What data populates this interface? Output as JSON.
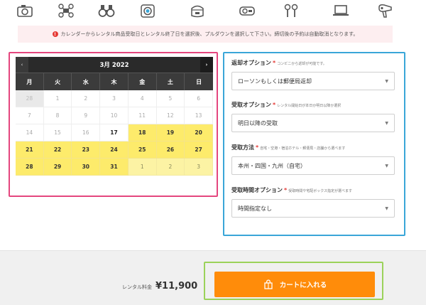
{
  "icons": [
    "camera-icon",
    "drone-icon",
    "binoculars-icon",
    "action-camera-icon",
    "rice-cooker-icon",
    "projector-icon",
    "earbuds-icon",
    "laptop-icon",
    "hair-dryer-icon"
  ],
  "notice": {
    "text": "カレンダーからレンタル商品受取日とレンタル終了日を選択後、プルダウンを選択して下さい。締切後の予約は自動取消となります。"
  },
  "calendar": {
    "title": "3月 2022",
    "prev": "‹",
    "next": "›",
    "weekdays": [
      "月",
      "火",
      "水",
      "木",
      "金",
      "土",
      "日"
    ],
    "days": [
      {
        "d": "28",
        "state": "grey"
      },
      {
        "d": "1",
        "state": "past"
      },
      {
        "d": "2",
        "state": "past"
      },
      {
        "d": "3",
        "state": "past"
      },
      {
        "d": "4",
        "state": "past"
      },
      {
        "d": "5",
        "state": "past"
      },
      {
        "d": "6",
        "state": "past"
      },
      {
        "d": "7",
        "state": "past"
      },
      {
        "d": "8",
        "state": "past"
      },
      {
        "d": "9",
        "state": "past"
      },
      {
        "d": "10",
        "state": "past"
      },
      {
        "d": "11",
        "state": "past"
      },
      {
        "d": "12",
        "state": "past"
      },
      {
        "d": "13",
        "state": "past"
      },
      {
        "d": "14",
        "state": "past"
      },
      {
        "d": "15",
        "state": "past"
      },
      {
        "d": "16",
        "state": "past"
      },
      {
        "d": "17",
        "state": "today"
      },
      {
        "d": "18",
        "state": "sel"
      },
      {
        "d": "19",
        "state": "sel"
      },
      {
        "d": "20",
        "state": "sel"
      },
      {
        "d": "21",
        "state": "sel"
      },
      {
        "d": "22",
        "state": "sel"
      },
      {
        "d": "23",
        "state": "sel"
      },
      {
        "d": "24",
        "state": "sel"
      },
      {
        "d": "25",
        "state": "sel"
      },
      {
        "d": "26",
        "state": "sel"
      },
      {
        "d": "27",
        "state": "sel"
      },
      {
        "d": "28",
        "state": "sel"
      },
      {
        "d": "29",
        "state": "sel"
      },
      {
        "d": "30",
        "state": "sel"
      },
      {
        "d": "31",
        "state": "sel"
      },
      {
        "d": "1",
        "state": "next"
      },
      {
        "d": "2",
        "state": "next"
      },
      {
        "d": "3",
        "state": "next"
      }
    ]
  },
  "options": {
    "return": {
      "label": "返却オプション",
      "req": "*",
      "hint": "コンビニから返却が可能です。",
      "value": "ローソンもしくは郵便局返却"
    },
    "pickup": {
      "label": "受取オプション",
      "req": "*",
      "hint": "レンタル開始日が本日か明日以降か選択",
      "value": "明日以降の受取"
    },
    "method": {
      "label": "受取方法",
      "req": "*",
      "hint": "自宅・空港・宿泊ホテル・郵便局・店舗から選べます",
      "value": "本州・四国・九州（自宅）"
    },
    "time": {
      "label": "受取時間オプション",
      "req": "*",
      "hint": "受取時間や宅配ボックス指定が選べます",
      "value": "時間指定なし"
    }
  },
  "price": {
    "label": "レンタル料金",
    "value": "¥11,900"
  },
  "cart": {
    "label": "カートに入れる"
  },
  "colors": {
    "accent": "#ff8c0a",
    "selected": "#fdeb6b",
    "calendar_frame": "#e4467e",
    "options_frame": "#3aa6d8",
    "cart_frame": "#9bd25a"
  }
}
